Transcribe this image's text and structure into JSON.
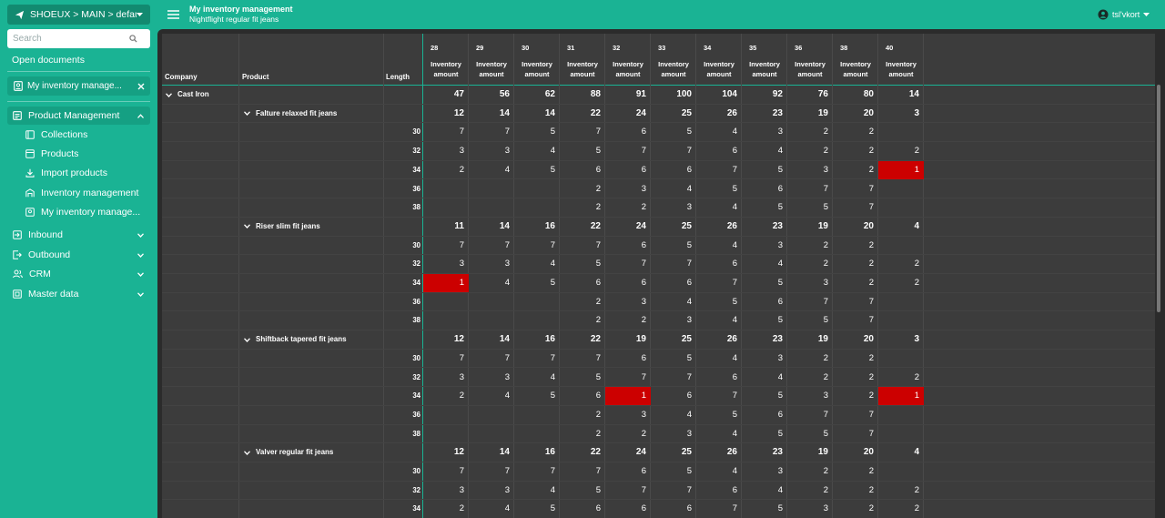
{
  "sidebar": {
    "tenant": "SHOEUX > MAIN > default",
    "search_placeholder": "Search",
    "open_documents": "Open documents",
    "open_doc_label": "My inventory manage...",
    "sections": [
      {
        "label": "Product Management",
        "icon": "clipboard-icon",
        "expanded": true
      },
      {
        "label": "Collections",
        "icon": "collection-icon"
      },
      {
        "label": "Products",
        "icon": "product-icon"
      },
      {
        "label": "Import products",
        "icon": "download-icon"
      },
      {
        "label": "Inventory management",
        "icon": "warehouse-icon"
      },
      {
        "label": "My inventory manage...",
        "icon": "document-icon"
      },
      {
        "label": "Inbound",
        "icon": "inbound-icon"
      },
      {
        "label": "Outbound",
        "icon": "outbound-icon"
      },
      {
        "label": "CRM",
        "icon": "people-icon"
      },
      {
        "label": "Master data",
        "icon": "database-icon"
      }
    ]
  },
  "topbar": {
    "title": "My inventory management",
    "subtitle": "Nightflight regular fit jeans",
    "user": "tsl'vkort"
  },
  "grid": {
    "headers": {
      "company": "Company",
      "product": "Product",
      "length": "Length"
    },
    "size_line1": "Inventory",
    "size_line2": "amount",
    "sizes": [
      "28",
      "29",
      "30",
      "31",
      "32",
      "33",
      "34",
      "35",
      "36",
      "38",
      "40"
    ],
    "company": {
      "name": "Cast Iron",
      "totals": [
        "47",
        "56",
        "62",
        "88",
        "91",
        "100",
        "104",
        "92",
        "76",
        "80",
        "14"
      ]
    },
    "products": [
      {
        "name": "Falture relaxed fit jeans",
        "totals": [
          "12",
          "14",
          "14",
          "22",
          "24",
          "25",
          "26",
          "23",
          "19",
          "20",
          "3"
        ],
        "rows": [
          {
            "length": "30",
            "values": [
              "7",
              "7",
              "5",
              "7",
              "6",
              "5",
              "4",
              "3",
              "2",
              "2",
              ""
            ]
          },
          {
            "length": "32",
            "values": [
              "3",
              "3",
              "4",
              "5",
              "7",
              "7",
              "6",
              "4",
              "2",
              "2",
              "2"
            ]
          },
          {
            "length": "34",
            "values": [
              "2",
              "4",
              "5",
              "6",
              "6",
              "6",
              "7",
              "5",
              "3",
              "2",
              "1"
            ]
          },
          {
            "length": "36",
            "values": [
              "",
              "",
              "",
              "2",
              "3",
              "4",
              "5",
              "6",
              "7",
              "7",
              ""
            ]
          },
          {
            "length": "38",
            "values": [
              "",
              "",
              "",
              "2",
              "2",
              "3",
              "4",
              "5",
              "5",
              "7",
              ""
            ]
          }
        ]
      },
      {
        "name": "Riser slim fit jeans",
        "totals": [
          "11",
          "14",
          "16",
          "22",
          "24",
          "25",
          "26",
          "23",
          "19",
          "20",
          "4"
        ],
        "rows": [
          {
            "length": "30",
            "values": [
              "7",
              "7",
              "7",
              "7",
              "6",
              "5",
              "4",
              "3",
              "2",
              "2",
              ""
            ]
          },
          {
            "length": "32",
            "values": [
              "3",
              "3",
              "4",
              "5",
              "7",
              "7",
              "6",
              "4",
              "2",
              "2",
              "2"
            ]
          },
          {
            "length": "34",
            "values": [
              "1",
              "4",
              "5",
              "6",
              "6",
              "6",
              "7",
              "5",
              "3",
              "2",
              "2"
            ]
          },
          {
            "length": "36",
            "values": [
              "",
              "",
              "",
              "2",
              "3",
              "4",
              "5",
              "6",
              "7",
              "7",
              ""
            ]
          },
          {
            "length": "38",
            "values": [
              "",
              "",
              "",
              "2",
              "2",
              "3",
              "4",
              "5",
              "5",
              "7",
              ""
            ]
          }
        ]
      },
      {
        "name": "Shiftback tapered fit jeans",
        "totals": [
          "12",
          "14",
          "16",
          "22",
          "19",
          "25",
          "26",
          "23",
          "19",
          "20",
          "3"
        ],
        "rows": [
          {
            "length": "30",
            "values": [
              "7",
              "7",
              "7",
              "7",
              "6",
              "5",
              "4",
              "3",
              "2",
              "2",
              ""
            ]
          },
          {
            "length": "32",
            "values": [
              "3",
              "3",
              "4",
              "5",
              "7",
              "7",
              "6",
              "4",
              "2",
              "2",
              "2"
            ]
          },
          {
            "length": "34",
            "values": [
              "2",
              "4",
              "5",
              "6",
              "1",
              "6",
              "7",
              "5",
              "3",
              "2",
              "1"
            ]
          },
          {
            "length": "36",
            "values": [
              "",
              "",
              "",
              "2",
              "3",
              "4",
              "5",
              "6",
              "7",
              "7",
              ""
            ]
          },
          {
            "length": "38",
            "values": [
              "",
              "",
              "",
              "2",
              "2",
              "3",
              "4",
              "5",
              "5",
              "7",
              ""
            ]
          }
        ]
      },
      {
        "name": "Valver regular fit jeans",
        "totals": [
          "12",
          "14",
          "16",
          "22",
          "24",
          "25",
          "26",
          "23",
          "19",
          "20",
          "4"
        ],
        "rows": [
          {
            "length": "30",
            "values": [
              "7",
              "7",
              "7",
              "7",
              "6",
              "5",
              "4",
              "3",
              "2",
              "2",
              ""
            ]
          },
          {
            "length": "32",
            "values": [
              "3",
              "3",
              "4",
              "5",
              "7",
              "7",
              "6",
              "4",
              "2",
              "2",
              "2"
            ]
          },
          {
            "length": "34",
            "values": [
              "2",
              "4",
              "5",
              "6",
              "6",
              "6",
              "7",
              "5",
              "3",
              "2",
              "2"
            ]
          }
        ]
      }
    ],
    "highlight_color": "#cc0000",
    "highlight_cells": [
      {
        "product": 0,
        "row": 2,
        "col": 10
      },
      {
        "product": 1,
        "row": 2,
        "col": 0
      },
      {
        "product": 2,
        "row": 2,
        "col": 4
      },
      {
        "product": 2,
        "row": 2,
        "col": 10
      }
    ]
  },
  "colors": {
    "accent": "#1ab394",
    "panel": "#3c3c3c"
  }
}
